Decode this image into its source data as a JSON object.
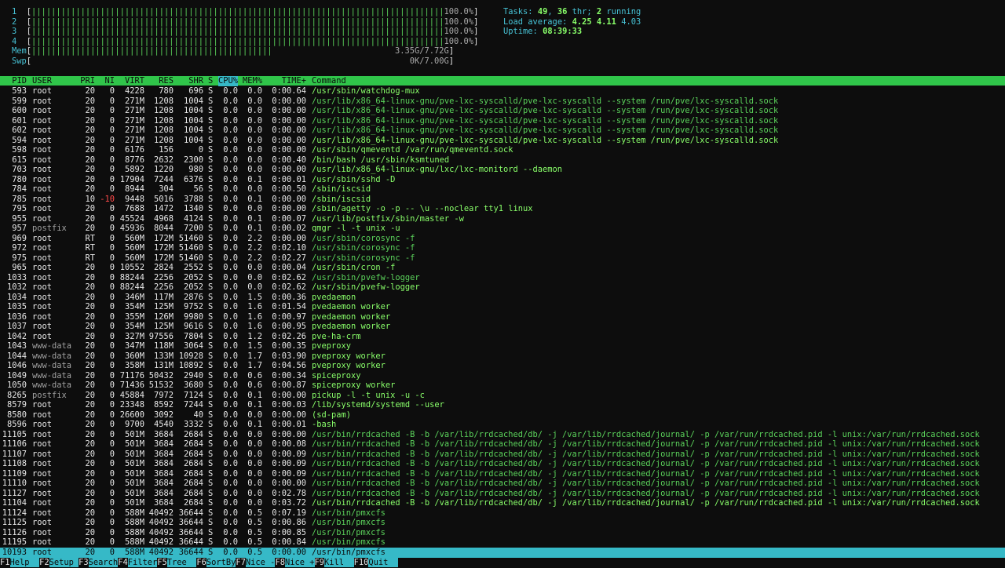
{
  "meters": {
    "cpus": [
      {
        "label": "1",
        "bar": "||||||||||||||||||||||||||||||||||||||||||||||||||||||||||||||||||||||||||||||||||||",
        "pct": "100.0%"
      },
      {
        "label": "2",
        "bar": "||||||||||||||||||||||||||||||||||||||||||||||||||||||||||||||||||||||||||||||||||||",
        "pct": "100.0%"
      },
      {
        "label": "3",
        "bar": "||||||||||||||||||||||||||||||||||||||||||||||||||||||||||||||||||||||||||||||||||||",
        "pct": "100.0%"
      },
      {
        "label": "4",
        "bar": "||||||||||||||||||||||||||||||||||||||||||||||||||||||||||||||||||||||||||||||||||||",
        "pct": "100.0%"
      }
    ],
    "mem": {
      "label": "Mem",
      "bar": "|||||||||||||||||||||||||||||||||||||||||||||||||",
      "value": "3.35G/7.72G"
    },
    "swp": {
      "label": "Swp",
      "bar": "",
      "value": "0K/7.00G"
    }
  },
  "summary": {
    "tasks_label": "Tasks:",
    "tasks": "49",
    "threads": "36",
    "thr_label": "thr;",
    "running": "2",
    "running_label": "running",
    "load_label": "Load average:",
    "load1": "4.25",
    "load5": "4.11",
    "load15": "4.03",
    "uptime_label": "Uptime:",
    "uptime": "08:39:33"
  },
  "columns": [
    "PID",
    "USER",
    "PRI",
    "NI",
    "VIRT",
    "RES",
    "SHR",
    "S",
    "CPU%",
    "MEM%",
    "TIME+",
    "Command"
  ],
  "processes": [
    {
      "pid": "593",
      "user": "root",
      "pri": "20",
      "ni": "0",
      "virt": "4228",
      "res": "780",
      "shr": "696",
      "s": "S",
      "cpu": "0.0",
      "mem": "0.0",
      "time": "0:00.64",
      "cmd": "/usr/sbin/watchdog-mux",
      "style": "bright"
    },
    {
      "pid": "599",
      "user": "root",
      "pri": "20",
      "ni": "0",
      "virt": "271M",
      "res": "1208",
      "shr": "1004",
      "s": "S",
      "cpu": "0.0",
      "mem": "0.0",
      "time": "0:00.00",
      "cmd": "/usr/lib/x86_64-linux-gnu/pve-lxc-syscalld/pve-lxc-syscalld --system /run/pve/lxc-syscalld.sock",
      "style": "thread"
    },
    {
      "pid": "600",
      "user": "root",
      "pri": "20",
      "ni": "0",
      "virt": "271M",
      "res": "1208",
      "shr": "1004",
      "s": "S",
      "cpu": "0.0",
      "mem": "0.0",
      "time": "0:00.00",
      "cmd": "/usr/lib/x86_64-linux-gnu/pve-lxc-syscalld/pve-lxc-syscalld --system /run/pve/lxc-syscalld.sock",
      "style": "thread"
    },
    {
      "pid": "601",
      "user": "root",
      "pri": "20",
      "ni": "0",
      "virt": "271M",
      "res": "1208",
      "shr": "1004",
      "s": "S",
      "cpu": "0.0",
      "mem": "0.0",
      "time": "0:00.00",
      "cmd": "/usr/lib/x86_64-linux-gnu/pve-lxc-syscalld/pve-lxc-syscalld --system /run/pve/lxc-syscalld.sock",
      "style": "thread"
    },
    {
      "pid": "602",
      "user": "root",
      "pri": "20",
      "ni": "0",
      "virt": "271M",
      "res": "1208",
      "shr": "1004",
      "s": "S",
      "cpu": "0.0",
      "mem": "0.0",
      "time": "0:00.00",
      "cmd": "/usr/lib/x86_64-linux-gnu/pve-lxc-syscalld/pve-lxc-syscalld --system /run/pve/lxc-syscalld.sock",
      "style": "thread"
    },
    {
      "pid": "594",
      "user": "root",
      "pri": "20",
      "ni": "0",
      "virt": "271M",
      "res": "1208",
      "shr": "1004",
      "s": "S",
      "cpu": "0.0",
      "mem": "0.0",
      "time": "0:00.00",
      "cmd": "/usr/lib/x86_64-linux-gnu/pve-lxc-syscalld/pve-lxc-syscalld --system /run/pve/lxc-syscalld.sock",
      "style": "bright"
    },
    {
      "pid": "598",
      "user": "root",
      "pri": "20",
      "ni": "0",
      "virt": "6176",
      "res": "156",
      "shr": "0",
      "s": "S",
      "cpu": "0.0",
      "mem": "0.0",
      "time": "0:00.00",
      "cmd": "/usr/sbin/qmeventd /var/run/qmeventd.sock",
      "style": "bright"
    },
    {
      "pid": "615",
      "user": "root",
      "pri": "20",
      "ni": "0",
      "virt": "8776",
      "res": "2632",
      "shr": "2300",
      "s": "S",
      "cpu": "0.0",
      "mem": "0.0",
      "time": "0:00.40",
      "cmd": "/bin/bash /usr/sbin/ksmtuned",
      "style": "bright"
    },
    {
      "pid": "703",
      "user": "root",
      "pri": "20",
      "ni": "0",
      "virt": "5892",
      "res": "1220",
      "shr": "980",
      "s": "S",
      "cpu": "0.0",
      "mem": "0.0",
      "time": "0:00.00",
      "cmd": "/usr/lib/x86_64-linux-gnu/lxc/lxc-monitord --daemon",
      "style": "bright"
    },
    {
      "pid": "780",
      "user": "root",
      "pri": "20",
      "ni": "0",
      "virt": "17904",
      "res": "7244",
      "shr": "6376",
      "s": "S",
      "cpu": "0.0",
      "mem": "0.1",
      "time": "0:00.01",
      "cmd": "/usr/sbin/sshd -D",
      "style": "bright"
    },
    {
      "pid": "784",
      "user": "root",
      "pri": "20",
      "ni": "0",
      "virt": "8944",
      "res": "304",
      "shr": "56",
      "s": "S",
      "cpu": "0.0",
      "mem": "0.0",
      "time": "0:00.50",
      "cmd": "/sbin/iscsid",
      "style": "bright"
    },
    {
      "pid": "785",
      "user": "root",
      "pri": "10",
      "ni": "-10",
      "virt": "9448",
      "res": "5016",
      "shr": "3788",
      "s": "S",
      "cpu": "0.0",
      "mem": "0.1",
      "time": "0:00.00",
      "cmd": "/sbin/iscsid",
      "style": "bright",
      "ni_red": true
    },
    {
      "pid": "795",
      "user": "root",
      "pri": "20",
      "ni": "0",
      "virt": "7688",
      "res": "1472",
      "shr": "1340",
      "s": "S",
      "cpu": "0.0",
      "mem": "0.0",
      "time": "0:00.00",
      "cmd": "/sbin/agetty -o -p -- \\u --noclear tty1 linux",
      "style": "bright"
    },
    {
      "pid": "955",
      "user": "root",
      "pri": "20",
      "ni": "0",
      "virt": "45524",
      "res": "4968",
      "shr": "4124",
      "s": "S",
      "cpu": "0.0",
      "mem": "0.1",
      "time": "0:00.07",
      "cmd": "/usr/lib/postfix/sbin/master -w",
      "style": "bright"
    },
    {
      "pid": "957",
      "user": "postfix",
      "pri": "20",
      "ni": "0",
      "virt": "45936",
      "res": "8044",
      "shr": "7200",
      "s": "S",
      "cpu": "0.0",
      "mem": "0.1",
      "time": "0:00.02",
      "cmd": "qmgr -l -t unix -u",
      "style": "bright",
      "user_gray": true
    },
    {
      "pid": "969",
      "user": "root",
      "pri": "RT",
      "ni": "0",
      "virt": "560M",
      "res": "172M",
      "shr": "51460",
      "s": "S",
      "cpu": "0.0",
      "mem": "2.2",
      "time": "0:00.00",
      "cmd": "/usr/sbin/corosync -f",
      "style": "thread"
    },
    {
      "pid": "972",
      "user": "root",
      "pri": "RT",
      "ni": "0",
      "virt": "560M",
      "res": "172M",
      "shr": "51460",
      "s": "S",
      "cpu": "0.0",
      "mem": "2.2",
      "time": "0:02.10",
      "cmd": "/usr/sbin/corosync -f",
      "style": "thread"
    },
    {
      "pid": "975",
      "user": "root",
      "pri": "RT",
      "ni": "0",
      "virt": "560M",
      "res": "172M",
      "shr": "51460",
      "s": "S",
      "cpu": "0.0",
      "mem": "2.2",
      "time": "0:02.27",
      "cmd": "/usr/sbin/corosync -f",
      "style": "thread"
    },
    {
      "pid": "965",
      "user": "root",
      "pri": "20",
      "ni": "0",
      "virt": "10552",
      "res": "2824",
      "shr": "2552",
      "s": "S",
      "cpu": "0.0",
      "mem": "0.0",
      "time": "0:00.04",
      "cmd": "/usr/sbin/cron -f",
      "style": "bright"
    },
    {
      "pid": "1033",
      "user": "root",
      "pri": "20",
      "ni": "0",
      "virt": "88244",
      "res": "2256",
      "shr": "2052",
      "s": "S",
      "cpu": "0.0",
      "mem": "0.0",
      "time": "0:02.62",
      "cmd": "/usr/sbin/pvefw-logger",
      "style": "thread"
    },
    {
      "pid": "1032",
      "user": "root",
      "pri": "20",
      "ni": "0",
      "virt": "88244",
      "res": "2256",
      "shr": "2052",
      "s": "S",
      "cpu": "0.0",
      "mem": "0.0",
      "time": "0:02.62",
      "cmd": "/usr/sbin/pvefw-logger",
      "style": "bright"
    },
    {
      "pid": "1034",
      "user": "root",
      "pri": "20",
      "ni": "0",
      "virt": "346M",
      "res": "117M",
      "shr": "2876",
      "s": "S",
      "cpu": "0.0",
      "mem": "1.5",
      "time": "0:00.36",
      "cmd": "pvedaemon",
      "style": "bright"
    },
    {
      "pid": "1035",
      "user": "root",
      "pri": "20",
      "ni": "0",
      "virt": "354M",
      "res": "125M",
      "shr": "9752",
      "s": "S",
      "cpu": "0.0",
      "mem": "1.6",
      "time": "0:01.54",
      "cmd": "pvedaemon worker",
      "style": "bright"
    },
    {
      "pid": "1036",
      "user": "root",
      "pri": "20",
      "ni": "0",
      "virt": "355M",
      "res": "126M",
      "shr": "9980",
      "s": "S",
      "cpu": "0.0",
      "mem": "1.6",
      "time": "0:00.97",
      "cmd": "pvedaemon worker",
      "style": "bright"
    },
    {
      "pid": "1037",
      "user": "root",
      "pri": "20",
      "ni": "0",
      "virt": "354M",
      "res": "125M",
      "shr": "9616",
      "s": "S",
      "cpu": "0.0",
      "mem": "1.6",
      "time": "0:00.95",
      "cmd": "pvedaemon worker",
      "style": "bright"
    },
    {
      "pid": "1042",
      "user": "root",
      "pri": "20",
      "ni": "0",
      "virt": "327M",
      "res": "97556",
      "shr": "7804",
      "s": "S",
      "cpu": "0.0",
      "mem": "1.2",
      "time": "0:02.26",
      "cmd": "pve-ha-crm",
      "style": "bright"
    },
    {
      "pid": "1043",
      "user": "www-data",
      "pri": "20",
      "ni": "0",
      "virt": "347M",
      "res": "118M",
      "shr": "3064",
      "s": "S",
      "cpu": "0.0",
      "mem": "1.5",
      "time": "0:00.35",
      "cmd": "pveproxy",
      "style": "bright",
      "user_gray": true
    },
    {
      "pid": "1044",
      "user": "www-data",
      "pri": "20",
      "ni": "0",
      "virt": "360M",
      "res": "133M",
      "shr": "10928",
      "s": "S",
      "cpu": "0.0",
      "mem": "1.7",
      "time": "0:03.90",
      "cmd": "pveproxy worker",
      "style": "bright",
      "user_gray": true
    },
    {
      "pid": "1046",
      "user": "www-data",
      "pri": "20",
      "ni": "0",
      "virt": "358M",
      "res": "131M",
      "shr": "10892",
      "s": "S",
      "cpu": "0.0",
      "mem": "1.7",
      "time": "0:04.56",
      "cmd": "pveproxy worker",
      "style": "bright",
      "user_gray": true
    },
    {
      "pid": "1049",
      "user": "www-data",
      "pri": "20",
      "ni": "0",
      "virt": "71176",
      "res": "50432",
      "shr": "2940",
      "s": "S",
      "cpu": "0.0",
      "mem": "0.6",
      "time": "0:00.34",
      "cmd": "spiceproxy",
      "style": "bright",
      "user_gray": true
    },
    {
      "pid": "1050",
      "user": "www-data",
      "pri": "20",
      "ni": "0",
      "virt": "71436",
      "res": "51532",
      "shr": "3680",
      "s": "S",
      "cpu": "0.0",
      "mem": "0.6",
      "time": "0:00.87",
      "cmd": "spiceproxy worker",
      "style": "bright",
      "user_gray": true
    },
    {
      "pid": "8265",
      "user": "postfix",
      "pri": "20",
      "ni": "0",
      "virt": "45884",
      "res": "7972",
      "shr": "7124",
      "s": "S",
      "cpu": "0.0",
      "mem": "0.1",
      "time": "0:00.00",
      "cmd": "pickup -l -t unix -u -c",
      "style": "bright",
      "user_gray": true
    },
    {
      "pid": "8579",
      "user": "root",
      "pri": "20",
      "ni": "0",
      "virt": "23348",
      "res": "8592",
      "shr": "7244",
      "s": "S",
      "cpu": "0.0",
      "mem": "0.1",
      "time": "0:00.03",
      "cmd": "/lib/systemd/systemd --user",
      "style": "bright"
    },
    {
      "pid": "8580",
      "user": "root",
      "pri": "20",
      "ni": "0",
      "virt": "26600",
      "res": "3092",
      "shr": "40",
      "s": "S",
      "cpu": "0.0",
      "mem": "0.0",
      "time": "0:00.00",
      "cmd": "(sd-pam)",
      "style": "bright"
    },
    {
      "pid": "8596",
      "user": "root",
      "pri": "20",
      "ni": "0",
      "virt": "9700",
      "res": "4540",
      "shr": "3332",
      "s": "S",
      "cpu": "0.0",
      "mem": "0.1",
      "time": "0:00.01",
      "cmd": "-bash",
      "style": "bright"
    },
    {
      "pid": "11105",
      "user": "root",
      "pri": "20",
      "ni": "0",
      "virt": "501M",
      "res": "3684",
      "shr": "2684",
      "s": "S",
      "cpu": "0.0",
      "mem": "0.0",
      "time": "0:00.00",
      "cmd": "/usr/bin/rrdcached -B -b /var/lib/rrdcached/db/ -j /var/lib/rrdcached/journal/ -p /var/run/rrdcached.pid -l unix:/var/run/rrdcached.sock",
      "style": "thread"
    },
    {
      "pid": "11106",
      "user": "root",
      "pri": "20",
      "ni": "0",
      "virt": "501M",
      "res": "3684",
      "shr": "2684",
      "s": "S",
      "cpu": "0.0",
      "mem": "0.0",
      "time": "0:00.08",
      "cmd": "/usr/bin/rrdcached -B -b /var/lib/rrdcached/db/ -j /var/lib/rrdcached/journal/ -p /var/run/rrdcached.pid -l unix:/var/run/rrdcached.sock",
      "style": "thread"
    },
    {
      "pid": "11107",
      "user": "root",
      "pri": "20",
      "ni": "0",
      "virt": "501M",
      "res": "3684",
      "shr": "2684",
      "s": "S",
      "cpu": "0.0",
      "mem": "0.0",
      "time": "0:00.09",
      "cmd": "/usr/bin/rrdcached -B -b /var/lib/rrdcached/db/ -j /var/lib/rrdcached/journal/ -p /var/run/rrdcached.pid -l unix:/var/run/rrdcached.sock",
      "style": "thread"
    },
    {
      "pid": "11108",
      "user": "root",
      "pri": "20",
      "ni": "0",
      "virt": "501M",
      "res": "3684",
      "shr": "2684",
      "s": "S",
      "cpu": "0.0",
      "mem": "0.0",
      "time": "0:00.09",
      "cmd": "/usr/bin/rrdcached -B -b /var/lib/rrdcached/db/ -j /var/lib/rrdcached/journal/ -p /var/run/rrdcached.pid -l unix:/var/run/rrdcached.sock",
      "style": "thread"
    },
    {
      "pid": "11109",
      "user": "root",
      "pri": "20",
      "ni": "0",
      "virt": "501M",
      "res": "3684",
      "shr": "2684",
      "s": "S",
      "cpu": "0.0",
      "mem": "0.0",
      "time": "0:00.09",
      "cmd": "/usr/bin/rrdcached -B -b /var/lib/rrdcached/db/ -j /var/lib/rrdcached/journal/ -p /var/run/rrdcached.pid -l unix:/var/run/rrdcached.sock",
      "style": "thread"
    },
    {
      "pid": "11110",
      "user": "root",
      "pri": "20",
      "ni": "0",
      "virt": "501M",
      "res": "3684",
      "shr": "2684",
      "s": "S",
      "cpu": "0.0",
      "mem": "0.0",
      "time": "0:00.00",
      "cmd": "/usr/bin/rrdcached -B -b /var/lib/rrdcached/db/ -j /var/lib/rrdcached/journal/ -p /var/run/rrdcached.pid -l unix:/var/run/rrdcached.sock",
      "style": "thread"
    },
    {
      "pid": "11127",
      "user": "root",
      "pri": "20",
      "ni": "0",
      "virt": "501M",
      "res": "3684",
      "shr": "2684",
      "s": "S",
      "cpu": "0.0",
      "mem": "0.0",
      "time": "0:02.78",
      "cmd": "/usr/bin/rrdcached -B -b /var/lib/rrdcached/db/ -j /var/lib/rrdcached/journal/ -p /var/run/rrdcached.pid -l unix:/var/run/rrdcached.sock",
      "style": "thread"
    },
    {
      "pid": "11104",
      "user": "root",
      "pri": "20",
      "ni": "0",
      "virt": "501M",
      "res": "3684",
      "shr": "2684",
      "s": "S",
      "cpu": "0.0",
      "mem": "0.0",
      "time": "0:03.72",
      "cmd": "/usr/bin/rrdcached -B -b /var/lib/rrdcached/db/ -j /var/lib/rrdcached/journal/ -p /var/run/rrdcached.pid -l unix:/var/run/rrdcached.sock",
      "style": "bright"
    },
    {
      "pid": "11124",
      "user": "root",
      "pri": "20",
      "ni": "0",
      "virt": "588M",
      "res": "40492",
      "shr": "36644",
      "s": "S",
      "cpu": "0.0",
      "mem": "0.5",
      "time": "0:07.19",
      "cmd": "/usr/bin/pmxcfs",
      "style": "thread"
    },
    {
      "pid": "11125",
      "user": "root",
      "pri": "20",
      "ni": "0",
      "virt": "588M",
      "res": "40492",
      "shr": "36644",
      "s": "S",
      "cpu": "0.0",
      "mem": "0.5",
      "time": "0:00.86",
      "cmd": "/usr/bin/pmxcfs",
      "style": "thread"
    },
    {
      "pid": "11126",
      "user": "root",
      "pri": "20",
      "ni": "0",
      "virt": "588M",
      "res": "40492",
      "shr": "36644",
      "s": "S",
      "cpu": "0.0",
      "mem": "0.5",
      "time": "0:00.85",
      "cmd": "/usr/bin/pmxcfs",
      "style": "thread"
    },
    {
      "pid": "11195",
      "user": "root",
      "pri": "20",
      "ni": "0",
      "virt": "588M",
      "res": "40492",
      "shr": "36644",
      "s": "S",
      "cpu": "0.0",
      "mem": "0.5",
      "time": "0:00.84",
      "cmd": "/usr/bin/pmxcfs",
      "style": "thread"
    }
  ],
  "selected": {
    "pid": "10193",
    "user": "root",
    "pri": "20",
    "ni": "0",
    "virt": "588M",
    "res": "40492",
    "shr": "36644",
    "s": "S",
    "cpu": "0.0",
    "mem": "0.5",
    "time": "0:00.00",
    "cmd": "/usr/bin/pmxcfs"
  },
  "footer": [
    {
      "key": "F1",
      "label": "Help  "
    },
    {
      "key": "F2",
      "label": "Setup "
    },
    {
      "key": "F3",
      "label": "Search"
    },
    {
      "key": "F4",
      "label": "Filter"
    },
    {
      "key": "F5",
      "label": "Tree  "
    },
    {
      "key": "F6",
      "label": "SortBy"
    },
    {
      "key": "F7",
      "label": "Nice -"
    },
    {
      "key": "F8",
      "label": "Nice +"
    },
    {
      "key": "F9",
      "label": "Kill  "
    },
    {
      "key": "F10",
      "label": "Quit  "
    }
  ],
  "colors": {
    "header_bg": "#30c54a",
    "selected_bg": "#36b9c7",
    "bar": "#5bd35b",
    "thread_cmd": "#5bd35b",
    "cmd": "#89ff6a"
  }
}
